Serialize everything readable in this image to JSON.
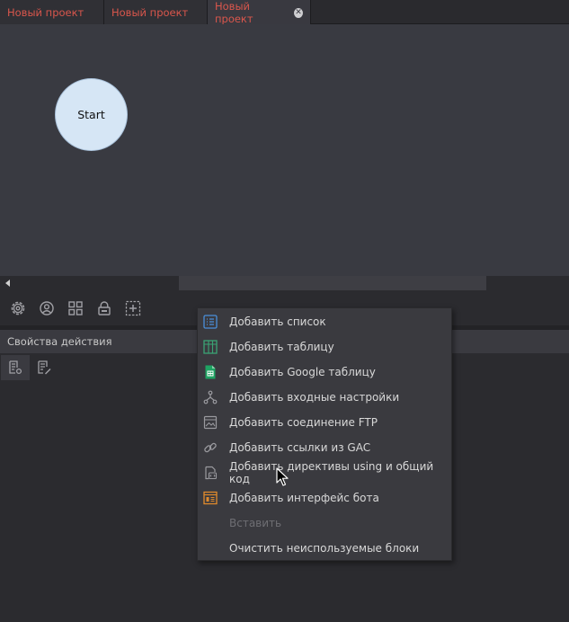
{
  "tabs": [
    {
      "label": "Новый проект",
      "active": false
    },
    {
      "label": "Новый проект",
      "active": false
    },
    {
      "label": "Новый проект",
      "active": true
    }
  ],
  "canvas": {
    "start_node_label": "Start"
  },
  "toolbar": {
    "icons": [
      "gear-icon",
      "user-circle-icon",
      "grid-icon",
      "lock-icon",
      "add-block-icon"
    ]
  },
  "properties": {
    "header": "Свойства действия"
  },
  "context_menu": {
    "items": [
      {
        "label": "Добавить список",
        "icon": "list-icon",
        "color": "#4a8fd9",
        "enabled": true
      },
      {
        "label": "Добавить таблицу",
        "icon": "table-icon",
        "color": "#3aa374",
        "enabled": true
      },
      {
        "label": "Добавить Google таблицу",
        "icon": "google-sheet-icon",
        "color": "#1fa463",
        "enabled": true
      },
      {
        "label": "Добавить входные настройки",
        "icon": "input-settings-icon",
        "color": "#9a9a9f",
        "enabled": true
      },
      {
        "label": "Добавить соединение FTP",
        "icon": "ftp-icon",
        "color": "#9a9a9f",
        "enabled": true
      },
      {
        "label": "Добавить ссылки из GAC",
        "icon": "link-icon",
        "color": "#9a9a9f",
        "enabled": true
      },
      {
        "label": "Добавить директивы using и общий код",
        "icon": "code-icon",
        "color": "#9a9a9f",
        "enabled": true
      },
      {
        "label": "Добавить интерфейс бота",
        "icon": "bot-interface-icon",
        "color": "#e08a2c",
        "enabled": true
      },
      {
        "label": "Вставить",
        "icon": "",
        "color": "",
        "enabled": false
      },
      {
        "label": "Очистить неиспользуемые блоки",
        "icon": "",
        "color": "",
        "enabled": true
      }
    ]
  },
  "colors": {
    "tab_text": "#d9564c",
    "canvas_bg": "#393a41",
    "start_node": "#d6e6f5",
    "menu_bg": "#3a3a3f"
  }
}
